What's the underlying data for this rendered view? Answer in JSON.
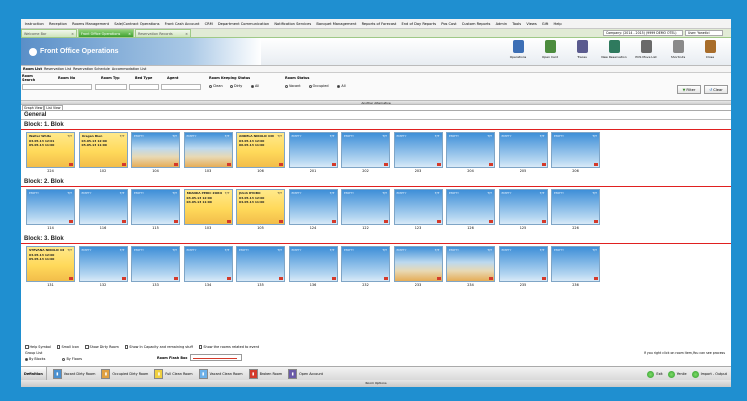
{
  "menu": [
    "Instruction",
    "Reception",
    "Rooms Management",
    "Sale/Contract Operations",
    "Front Cash Account",
    "CRM",
    "Department Communication",
    "Notification Services",
    "Banquet Management",
    "Reports of Forecast",
    "End of Day Reports",
    "Pos Cost",
    "Custom Reports",
    "Admin",
    "Tools",
    "Views",
    "Gift",
    "Help"
  ],
  "window_tabs": [
    {
      "label": "Welcome Bar",
      "active": false
    },
    {
      "label": "Front Office Operations",
      "active": true
    },
    {
      "label": "Reservation Records",
      "active": false
    }
  ],
  "company": "Company: (2014 - 2015) (9999 DEMO OTEL)",
  "user": "User: Yonetici",
  "page_title": "Front Office Operations",
  "toolbar": [
    {
      "label": "Operations",
      "color": "#3d6fb5"
    },
    {
      "label": "Open Card",
      "color": "#4c8c3e"
    },
    {
      "label": "Traces",
      "color": "#5b5b8f"
    },
    {
      "label": "New Reservation",
      "color": "#2f7a5e"
    },
    {
      "label": "POS Move List",
      "color": "#6a6a6a"
    },
    {
      "label": "Shortcuts",
      "color": "#8a8a8a"
    },
    {
      "label": "Close",
      "color": "#a86d2a"
    }
  ],
  "subtabs": [
    "Room List",
    "Reservation List",
    "Reservation Schedule",
    "Accommodation List"
  ],
  "filters": {
    "room_search_label": "Room Search",
    "room_no_label": "Room No",
    "room_type_label": "Room Typ",
    "bed_type_label": "Bed Type",
    "agent_label": "Agent",
    "housekeeping_label": "Room Keeping Status",
    "housekeeping_options": [
      "Clean",
      "Dirty",
      "All"
    ],
    "housekeeping_selected": 2,
    "room_status_label": "Room Status",
    "room_status_options": [
      "Vacant",
      "Occupied",
      "All"
    ],
    "room_status_selected": 2,
    "filter_btn": "Filter",
    "clear_btn": "Clear"
  },
  "alt_bar": "Another Alternative",
  "view_tabs": [
    "Graph View",
    "List View"
  ],
  "general_label": "General",
  "blocks": [
    {
      "name": "Block: 1. Blok",
      "rooms": [
        {
          "no": "224",
          "state": "oc",
          "guest": "Walter White",
          "bed": "T/T",
          "d1": "03.05.13 12:01",
          "d2": "05.05.13 11:00"
        },
        {
          "no": "102",
          "state": "oc",
          "guest": "Dragan Bien",
          "bed": "T/T",
          "d1": "03.05.13 12:00",
          "d2": "05.05.13 11:00"
        },
        {
          "no": "104",
          "state": "vd",
          "status": "EMPTY",
          "bed": "T/T"
        },
        {
          "no": "103",
          "state": "vd",
          "status": "EMPTY",
          "bed": "T/T"
        },
        {
          "no": "106",
          "state": "oc",
          "guest": "ANDELA NIKOLIC DUL...",
          "bed": "T/T",
          "d1": "03.05.13 12:00",
          "d2": "06.05.13 11:00"
        },
        {
          "no": "201",
          "state": "vc",
          "status": "EMPTY",
          "bed": "T/T"
        },
        {
          "no": "202",
          "state": "vc",
          "status": "EMPTY",
          "bed": "T/T"
        },
        {
          "no": "203",
          "state": "vc",
          "status": "EMPTY",
          "bed": "T/T"
        },
        {
          "no": "204",
          "state": "vc",
          "status": "EMPTY",
          "bed": "T/T"
        },
        {
          "no": "205",
          "state": "vc",
          "status": "EMPTY",
          "bed": "T/T"
        },
        {
          "no": "206",
          "state": "vc",
          "status": "EMPTY",
          "bed": "T/T"
        }
      ]
    },
    {
      "name": "Block: 2. Blok",
      "rooms": [
        {
          "no": "114",
          "state": "vc",
          "status": "EMPTY",
          "bed": "T/T"
        },
        {
          "no": "116",
          "state": "vc",
          "status": "EMPTY",
          "bed": "T/T"
        },
        {
          "no": "115",
          "state": "vc",
          "status": "EMPTY",
          "bed": "T/T"
        },
        {
          "no": "103",
          "state": "oc",
          "guest": "BRANKA PERIC ZORICA...",
          "bed": "T/T",
          "d1": "03.05.13 12:00",
          "d2": "04.05.13 11:00"
        },
        {
          "no": "105",
          "state": "oc",
          "guest": "JULIA RYOBO",
          "bed": "T/T",
          "d1": "03.05.13 12:00",
          "d2": "04.05.13 11:00"
        },
        {
          "no": "124",
          "state": "vc",
          "status": "EMPTY",
          "bed": "T/T"
        },
        {
          "no": "122",
          "state": "vc",
          "status": "EMPTY",
          "bed": "T/T"
        },
        {
          "no": "123",
          "state": "vc",
          "status": "EMPTY",
          "bed": "T/T"
        },
        {
          "no": "126",
          "state": "vc",
          "status": "EMPTY",
          "bed": "T/T"
        },
        {
          "no": "125",
          "state": "vc",
          "status": "EMPTY",
          "bed": "T/T"
        },
        {
          "no": "226",
          "state": "vc",
          "status": "EMPTY",
          "bed": "T/T"
        }
      ]
    },
    {
      "name": "Block: 3. Blok",
      "rooms": [
        {
          "no": "131",
          "state": "oc",
          "guest": "STEVANA NIKOLIC DR...",
          "bed": "T/T",
          "d1": "03.05.13 12:00",
          "d2": "05.05.13 11:00"
        },
        {
          "no": "132",
          "state": "vc",
          "status": "EMPTY",
          "bed": "T/T"
        },
        {
          "no": "133",
          "state": "vc",
          "status": "EMPTY",
          "bed": "T/T"
        },
        {
          "no": "134",
          "state": "vc",
          "status": "EMPTY",
          "bed": "T/T"
        },
        {
          "no": "135",
          "state": "vc",
          "status": "EMPTY",
          "bed": "T/T"
        },
        {
          "no": "136",
          "state": "vc",
          "status": "EMPTY",
          "bed": "T/T"
        },
        {
          "no": "232",
          "state": "vc",
          "status": "EMPTY",
          "bed": "T/T"
        },
        {
          "no": "233",
          "state": "vd",
          "status": "EMPTY",
          "bed": "T/T"
        },
        {
          "no": "234",
          "state": "vd",
          "status": "EMPTY",
          "bed": "T/T"
        },
        {
          "no": "235",
          "state": "vc",
          "status": "EMPTY",
          "bed": "T/T"
        },
        {
          "no": "236",
          "state": "vc",
          "status": "EMPTY",
          "bed": "T/T"
        }
      ]
    }
  ],
  "options": [
    "Help Symbol",
    "Small Icon",
    "Show Dirty Room",
    "Show In Capacity and remaining stuff",
    "Show the rooms related to event"
  ],
  "group": {
    "label": "Group List",
    "by_blocks": "By Blocks",
    "by_floors": "By Floors"
  },
  "room_flash_label": "Room Flash Box",
  "right_note": "If you right click on room item,You can see process",
  "legend_lead": "Definition",
  "legend": [
    {
      "label": "Vacant Dirty Room",
      "color": "#4a90d0"
    },
    {
      "label": "Occupied Dirty Room",
      "color": "#e0a040"
    },
    {
      "label": "Full Clean Room",
      "color": "#f0d040"
    },
    {
      "label": "Vacant Clean Room",
      "color": "#6db0e8"
    },
    {
      "label": "Broken Room",
      "color": "#d43a2a"
    },
    {
      "label": "Open Account",
      "color": "#6a5aa8"
    }
  ],
  "bottom_buttons": [
    "Exit",
    "Yenile",
    "Import - Output"
  ],
  "status_bar": "Room Options"
}
